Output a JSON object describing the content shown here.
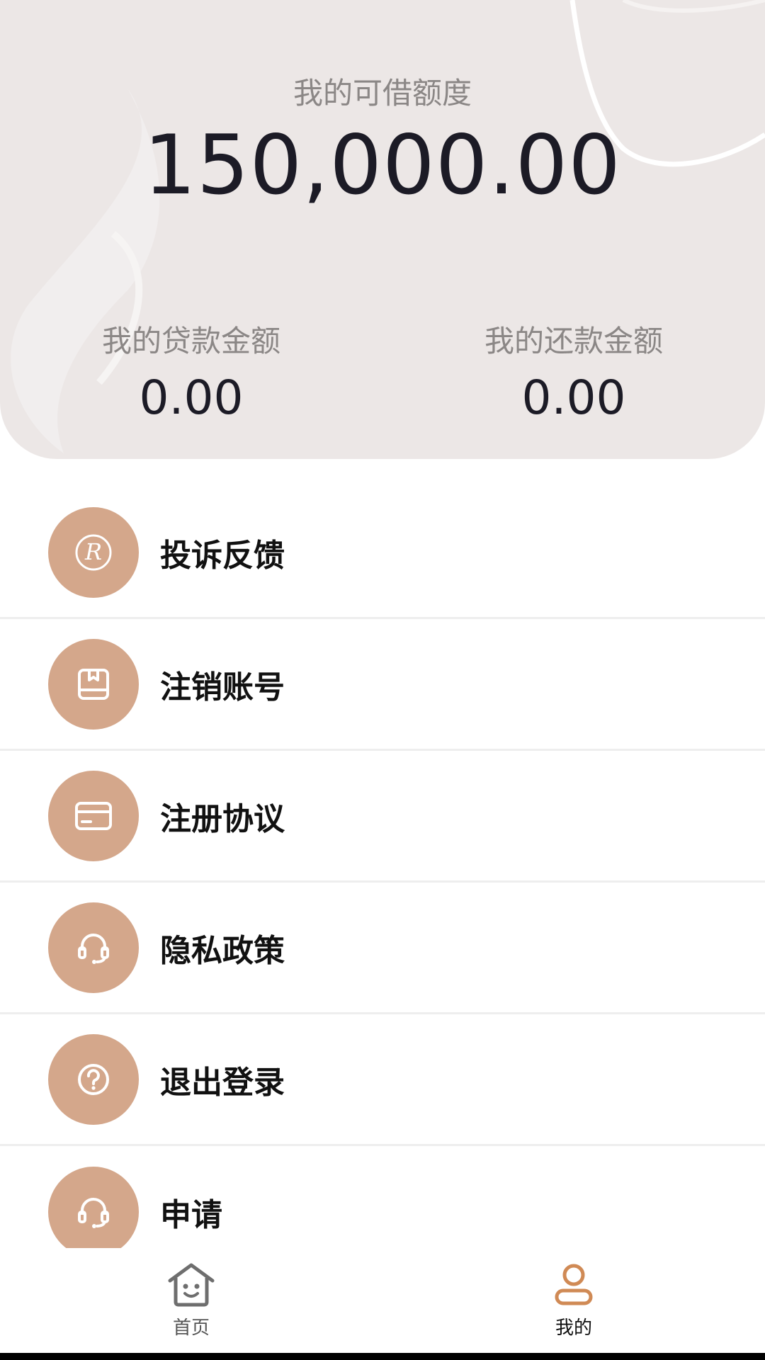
{
  "header": {
    "credit_label": "我的可借额度",
    "credit_amount": "150,000.00",
    "loan": {
      "label": "我的贷款金额",
      "value": "0.00"
    },
    "repay": {
      "label": "我的还款金额",
      "value": "0.00"
    }
  },
  "menu": {
    "items": [
      {
        "label": "投诉反馈",
        "icon": "r-logo-icon"
      },
      {
        "label": "注销账号",
        "icon": "book-icon"
      },
      {
        "label": "注册协议",
        "icon": "card-icon"
      },
      {
        "label": "隐私政策",
        "icon": "headset-icon"
      },
      {
        "label": "退出登录",
        "icon": "question-circle-icon"
      },
      {
        "label": "申请",
        "icon": "headset-icon"
      }
    ]
  },
  "tabbar": {
    "home_label": "首页",
    "mine_label": "我的"
  },
  "colors": {
    "header_bg": "#ece7e6",
    "icon_bg": "#d4a78b",
    "accent": "#d08a55"
  }
}
